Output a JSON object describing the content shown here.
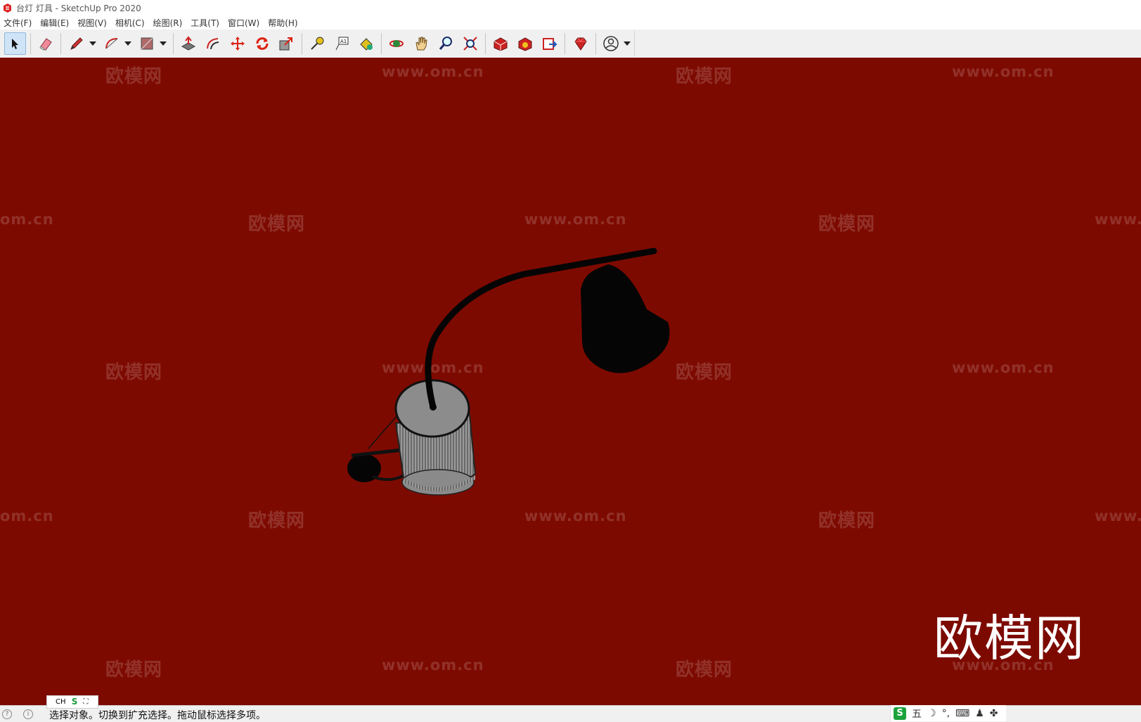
{
  "window": {
    "title": "台灯 灯具 - SketchUp Pro 2020"
  },
  "menu": {
    "items": [
      "文件(F)",
      "编辑(E)",
      "视图(V)",
      "相机(C)",
      "绘图(R)",
      "工具(T)",
      "窗口(W)",
      "帮助(H)"
    ]
  },
  "toolbar": {
    "tools": [
      "select-tool",
      "eraser-tool",
      "pencil-tool",
      "arc-tool",
      "shape-tool",
      "push-pull-tool",
      "offset-tool",
      "move-tool",
      "rotate-tool",
      "scale-tool",
      "tape-measure-tool",
      "text-tool",
      "paint-bucket-tool",
      "orbit-tool",
      "pan-tool",
      "zoom-tool",
      "zoom-extents-tool",
      "3d-warehouse-tool",
      "extension-warehouse-tool",
      "layout-tool",
      "extension-manager-tool",
      "account-tool"
    ],
    "active_tool": "select-tool"
  },
  "viewport": {
    "background_color": "#7d0a00",
    "watermark_text": "欧模网",
    "watermark_url": "www.om.cn",
    "watermark_url_partial": "om.cn",
    "watermark_url_cut": "www.",
    "brand_logo": "欧模网"
  },
  "ime": {
    "lang": "CH",
    "engine": "S",
    "expand": "⛶"
  },
  "status": {
    "text": "选择对象。切换到扩充选择。拖动鼠标选择多项。"
  },
  "tray": {
    "engine": "S",
    "mode": "五",
    "moon": "☽",
    "punct": "°,",
    "keyboard": "⌨",
    "user": "♟",
    "apps": "✤"
  }
}
